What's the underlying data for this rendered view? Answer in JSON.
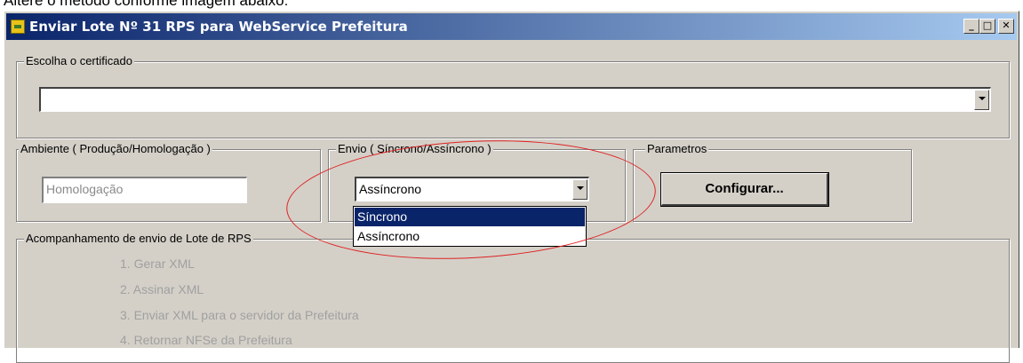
{
  "caption": "Altere o método conforme imagem abaixo:",
  "window": {
    "title": "Enviar Lote Nº 31 RPS para WebService Prefeitura",
    "minimize": "_",
    "maximize": "□",
    "close": "✕"
  },
  "certificate": {
    "legend": "Escolha o certificado",
    "value": ""
  },
  "ambiente": {
    "legend": "Ambiente ( Produção/Homologação )",
    "value": "Homologação"
  },
  "envio": {
    "legend": "Envio ( Síncrono/Assíncrono )",
    "selected": "Assíncrono",
    "options": [
      "Síncrono",
      "Assíncrono"
    ]
  },
  "parametros": {
    "legend": "Parametros",
    "button": "Configurar..."
  },
  "acompanhamento": {
    "legend": "Acompanhamento de envio de Lote de RPS",
    "steps": [
      "1. Gerar XML",
      "2. Assinar XML",
      "3. Enviar XML para o servidor da Prefeitura",
      "4. Retornar NFSe da Prefeitura"
    ]
  },
  "colors": {
    "title_bar": "#0a246a",
    "selection": "#0a246a",
    "annotation": "#e02020"
  }
}
